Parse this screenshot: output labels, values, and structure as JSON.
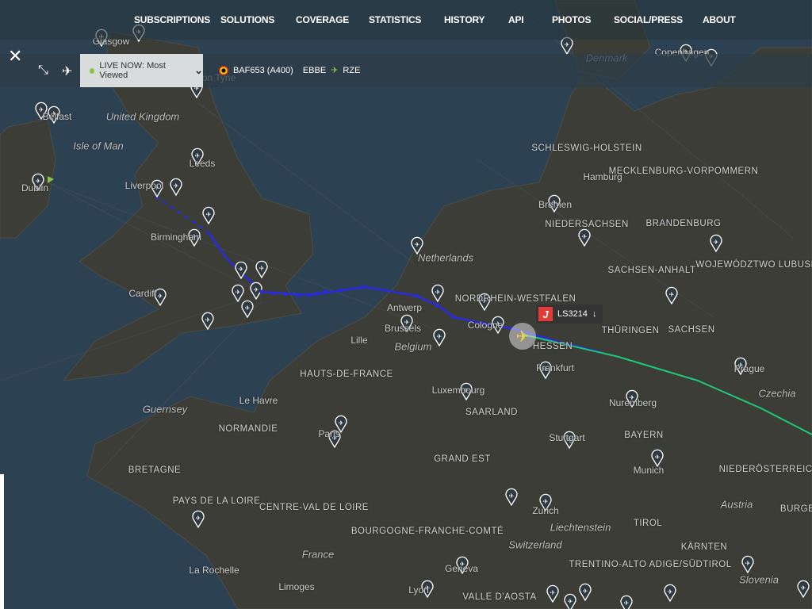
{
  "nav": {
    "items": [
      "SUBSCRIPTIONS",
      "SOLUTIONS",
      "COVERAGE",
      "STATISTICS",
      "HISTORY",
      "API",
      "PHOTOS",
      "SOCIAL/PRESS",
      "ABOUT"
    ]
  },
  "toolbar": {
    "close_icon": "close-icon",
    "collapse_icon": "collapse-arrows-icon",
    "aircraft_filter_icon": "planes-icon",
    "live_label": "LIVE NOW: Most Viewed",
    "live_status_color": "#8bc34a"
  },
  "selected_flight": {
    "callsign": "BAF653 (A400)",
    "origin": "EBBE",
    "destination": "RZE",
    "flag": "Belgium"
  },
  "callout": {
    "logo": "J",
    "flight": "LS3214",
    "trend": "↓"
  },
  "colors": {
    "sea": "#2c4152",
    "land": "#3b3d36",
    "track_blue": "#2a2ae0",
    "track_green": "#1ec87a",
    "aircraft": "#e8d44d"
  },
  "map": {
    "labels": [
      "Glasgow",
      "Newcastle upon Tyne",
      "United Kingdom",
      "Isle of Man",
      "Belfast",
      "Dublin",
      "Leeds",
      "Liverpool",
      "Birmingham",
      "Cardiff",
      "SCHLESWIG-HOLSTEIN",
      "Hamburg",
      "MECKLENBURG-VORPOMMERN",
      "Bremen",
      "NIEDERSACHSEN",
      "BRANDENBURG",
      "WOJEWÓDZTWO LUBUSKIE",
      "SACHSEN-ANHALT",
      "Netherlands",
      "NORDRHEIN-WESTFALEN",
      "Antwerp",
      "Brussels",
      "Belgium",
      "Lille",
      "Cologne",
      "THÜRINGEN",
      "SACHSEN",
      "HESSEN",
      "Frankfurt",
      "Prague",
      "Czechia",
      "HAUTS-DE-FRANCE",
      "Luxembourg",
      "SAARLAND",
      "Nuremberg",
      "Le Havre",
      "Guernsey",
      "NORMANDIE",
      "Paris",
      "Stuttgart",
      "BAYERN",
      "GRAND EST",
      "Munich",
      "NIEDERÖSTERREICH",
      "BRETAGNE",
      "PAYS DE LA LOIRE",
      "CENTRE-VAL DE LOIRE",
      "Zurich",
      "Liechtenstein",
      "TIROL",
      "Austria",
      "BURGEN",
      "BOURGOGNE-FRANCHE-COMTÉ",
      "Switzerland",
      "France",
      "KÄRNTEN",
      "TRENTINO-ALTO ADIGE/SÜDTIROL",
      "Slovenia",
      "La Rochelle",
      "Limoges",
      "Geneva",
      "Lyon",
      "VALLE D'AOSTA",
      "Denmark",
      "Copenhagen"
    ]
  }
}
